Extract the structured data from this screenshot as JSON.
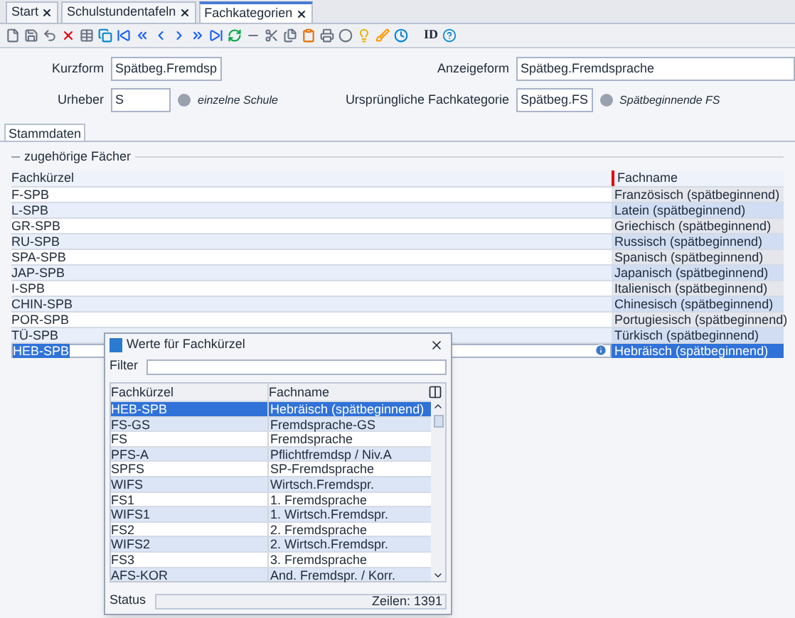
{
  "tabs": [
    {
      "label": "Start",
      "selected": false
    },
    {
      "label": "Schulstundentafeln",
      "selected": false
    },
    {
      "label": "Fachkategorien",
      "selected": true
    }
  ],
  "toolbar": {
    "id_label": "ID"
  },
  "form": {
    "kurzform": {
      "label": "Kurzform",
      "value": "Spätbeg.Fremdsp"
    },
    "urheber": {
      "label": "Urheber",
      "value": "S",
      "note": "einzelne Schule"
    },
    "anzeigeform": {
      "label": "Anzeigeform",
      "value": "Spätbeg.Fremdsprache"
    },
    "urspruengliche_fachkategorie": {
      "label": "Ursprüngliche Fachkategorie",
      "value": "Spätbeg.FS",
      "note": "Spätbeginnende FS"
    }
  },
  "section_tabs": [
    {
      "label": "Stammdaten",
      "selected": true
    }
  ],
  "group": {
    "title": "zugehörige Fächer",
    "columns": [
      "Fachkürzel",
      "Fachname"
    ],
    "rows": [
      {
        "kuerzel": "F-SPB",
        "name": "Französisch (spätbeginnend)",
        "selected": false
      },
      {
        "kuerzel": "L-SPB",
        "name": "Latein (spätbeginnend)",
        "selected": false
      },
      {
        "kuerzel": "GR-SPB",
        "name": "Griechisch (spätbeginnend)",
        "selected": false
      },
      {
        "kuerzel": "RU-SPB",
        "name": "Russisch (spätbeginnend)",
        "selected": false
      },
      {
        "kuerzel": "SPA-SPB",
        "name": "Spanisch (spätbeginnend)",
        "selected": false
      },
      {
        "kuerzel": "JAP-SPB",
        "name": "Japanisch (spätbeginnend)",
        "selected": false
      },
      {
        "kuerzel": "I-SPB",
        "name": "Italienisch (spätbeginnend)",
        "selected": false
      },
      {
        "kuerzel": "CHIN-SPB",
        "name": "Chinesisch (spätbeginnend)",
        "selected": false
      },
      {
        "kuerzel": "POR-SPB",
        "name": "Portugiesisch (spätbeginnend)",
        "selected": false
      },
      {
        "kuerzel": "TÜ-SPB",
        "name": "Türkisch (spätbeginnend)",
        "selected": false
      },
      {
        "kuerzel": "HEB-SPB",
        "name": "Hebräisch (spätbeginnend)",
        "selected": true
      }
    ]
  },
  "dialog": {
    "title": "Werte für Fachkürzel",
    "filter_label": "Filter",
    "columns": [
      "Fachkürzel",
      "Fachname"
    ],
    "rows": [
      {
        "kuerzel": "HEB-SPB",
        "name": "Hebräisch (spätbeginnend)",
        "selected": true
      },
      {
        "kuerzel": "FS-GS",
        "name": "Fremdsprache-GS",
        "selected": false
      },
      {
        "kuerzel": "FS",
        "name": "Fremdsprache",
        "selected": false
      },
      {
        "kuerzel": "PFS-A",
        "name": "Pflichtfremdsp / Niv.A",
        "selected": false
      },
      {
        "kuerzel": "SPFS",
        "name": "SP-Fremdsprache",
        "selected": false
      },
      {
        "kuerzel": "WIFS",
        "name": "Wirtsch.Fremdspr.",
        "selected": false
      },
      {
        "kuerzel": "FS1",
        "name": "1. Fremdsprache",
        "selected": false
      },
      {
        "kuerzel": "WIFS1",
        "name": "1. Wirtsch.Fremdspr.",
        "selected": false
      },
      {
        "kuerzel": "FS2",
        "name": "2. Fremdsprache",
        "selected": false
      },
      {
        "kuerzel": "WIFS2",
        "name": "2. Wirtsch.Fremdspr.",
        "selected": false
      },
      {
        "kuerzel": "FS3",
        "name": "3. Fremdsprache",
        "selected": false
      },
      {
        "kuerzel": "AFS-KOR",
        "name": "And. Fremdspr. / Korr.",
        "selected": false
      }
    ],
    "status_label": "Status",
    "row_count": "Zeilen: 1391"
  }
}
